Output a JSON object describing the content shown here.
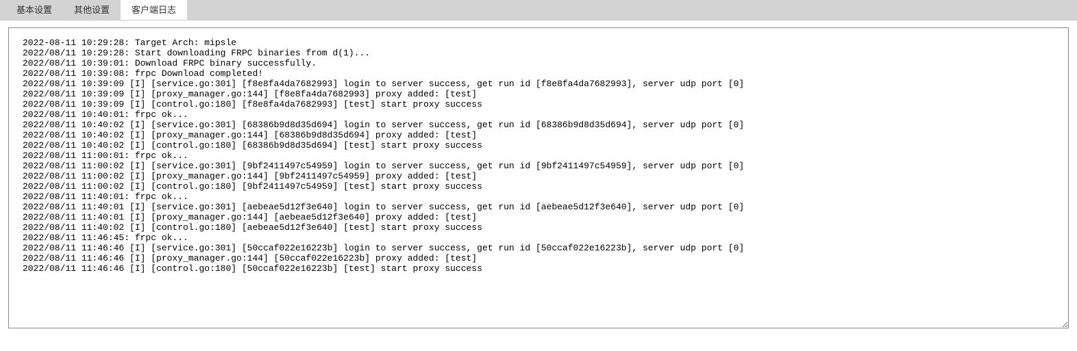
{
  "tabs": [
    {
      "label": "基本设置",
      "active": false
    },
    {
      "label": "其他设置",
      "active": false
    },
    {
      "label": "客户端日志",
      "active": true
    }
  ],
  "log_lines": [
    "2022-08-11 10:29:28: Target Arch: mipsle",
    "2022/08/11 10:29:28: Start downloading FRPC binaries from d(1)...",
    "2022/08/11 10:39:01: Download FRPC binary successfully.",
    "2022/08/11 10:39:08: frpc Download completed!",
    "2022/08/11 10:39:09 [I] [service.go:301] [f8e8fa4da7682993] login to server success, get run id [f8e8fa4da7682993], server udp port [0]",
    "2022/08/11 10:39:09 [I] [proxy_manager.go:144] [f8e8fa4da7682993] proxy added: [test]",
    "2022/08/11 10:39:09 [I] [control.go:180] [f8e8fa4da7682993] [test] start proxy success",
    "2022/08/11 10:40:01: frpc ok...",
    "2022/08/11 10:40:02 [I] [service.go:301] [68386b9d8d35d694] login to server success, get run id [68386b9d8d35d694], server udp port [0]",
    "2022/08/11 10:40:02 [I] [proxy_manager.go:144] [68386b9d8d35d694] proxy added: [test]",
    "2022/08/11 10:40:02 [I] [control.go:180] [68386b9d8d35d694] [test] start proxy success",
    "2022/08/11 11:00:01: frpc ok...",
    "2022/08/11 11:00:02 [I] [service.go:301] [9bf2411497c54959] login to server success, get run id [9bf2411497c54959], server udp port [0]",
    "2022/08/11 11:00:02 [I] [proxy_manager.go:144] [9bf2411497c54959] proxy added: [test]",
    "2022/08/11 11:00:02 [I] [control.go:180] [9bf2411497c54959] [test] start proxy success",
    "2022/08/11 11:40:01: frpc ok...",
    "2022/08/11 11:40:01 [I] [service.go:301] [aebeae5d12f3e640] login to server success, get run id [aebeae5d12f3e640], server udp port [0]",
    "2022/08/11 11:40:01 [I] [proxy_manager.go:144] [aebeae5d12f3e640] proxy added: [test]",
    "2022/08/11 11:40:02 [I] [control.go:180] [aebeae5d12f3e640] [test] start proxy success",
    "2022/08/11 11:46:45: frpc ok...",
    "2022/08/11 11:46:46 [I] [service.go:301] [50ccaf022e16223b] login to server success, get run id [50ccaf022e16223b], server udp port [0]",
    "2022/08/11 11:46:46 [I] [proxy_manager.go:144] [50ccaf022e16223b] proxy added: [test]",
    "2022/08/11 11:46:46 [I] [control.go:180] [50ccaf022e16223b] [test] start proxy success"
  ]
}
